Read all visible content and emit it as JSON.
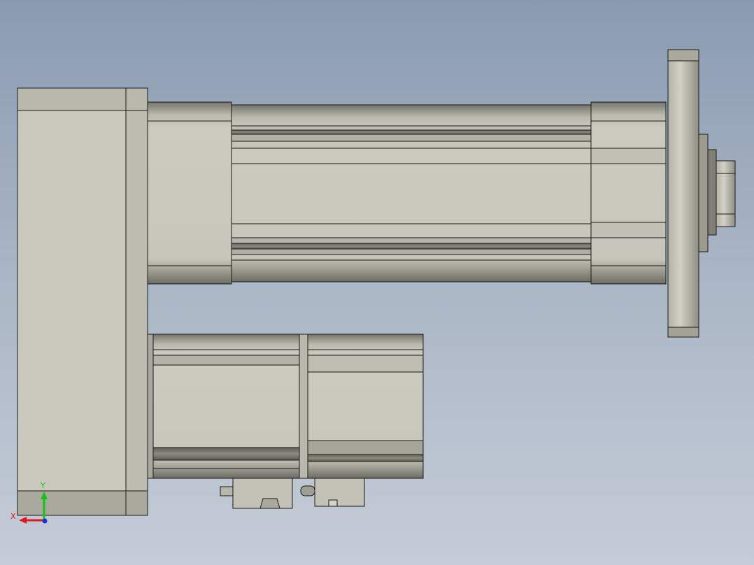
{
  "view": {
    "background_top": "#8a9bb1",
    "background_bottom": "#c5ccd8"
  },
  "model": {
    "part_color": "#c8c8bd",
    "shade_color": "#7d7d73",
    "edge_color": "#1a1a1a"
  },
  "triad": {
    "x_label": "X",
    "y_label": "Y",
    "x_color": "#e01818",
    "y_color": "#18c018",
    "z_color": "#1830e0"
  }
}
